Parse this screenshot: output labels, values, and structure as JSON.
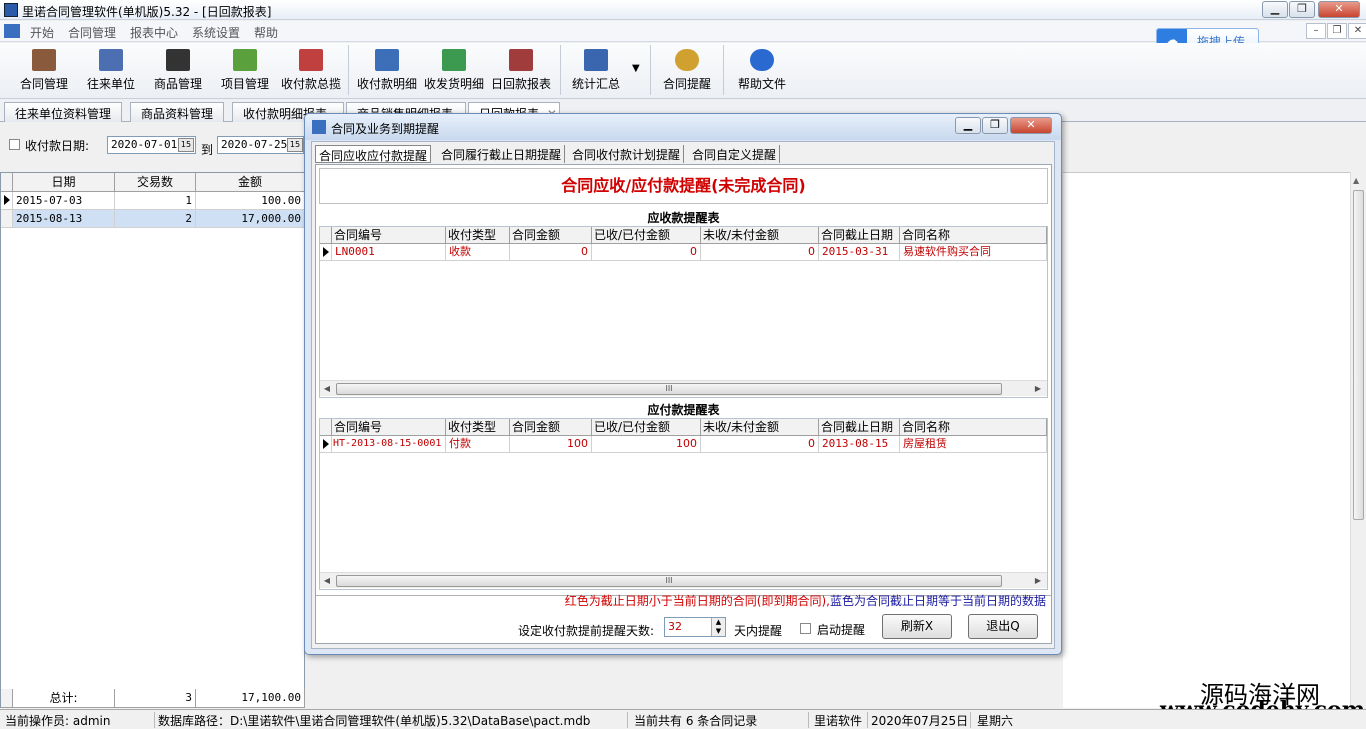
{
  "window": {
    "title": "里诺合同管理软件(单机版)5.32 - [日回款报表]"
  },
  "menu": [
    "开始",
    "合同管理",
    "报表中心",
    "系统设置",
    "帮助"
  ],
  "upload_button": "拖拽上传",
  "toolbar": [
    "合同管理",
    "往来单位",
    "商品管理",
    "项目管理",
    "收付款总揽",
    "收付款明细",
    "收发货明细",
    "日回款报表",
    "统计汇总",
    "合同提醒",
    "帮助文件"
  ],
  "tabs": [
    "往来单位资料管理",
    "商品资料管理",
    "收付款明细报表",
    "商品销售明细报表",
    "日回款报表"
  ],
  "filter": {
    "label": "收付款日期:",
    "from": "2020-07-01",
    "to_label": "到",
    "to": "2020-07-25",
    "cal_btn": "15"
  },
  "left_grid": {
    "headers": [
      "日期",
      "交易数",
      "金额"
    ],
    "rows": [
      [
        "2015-07-03",
        "1",
        "100.00"
      ],
      [
        "2015-08-13",
        "2",
        "17,000.00"
      ]
    ],
    "footer": [
      "总计:",
      "3",
      "17,100.00"
    ]
  },
  "dialog": {
    "title": "合同及业务到期提醒",
    "tabs": [
      "合同应收应付款提醒",
      "合同履行截止日期提醒",
      "合同收付款计划提醒",
      "合同自定义提醒"
    ],
    "banner": "合同应收/应付款提醒(未完成合同)",
    "receivable": {
      "title": "应收款提醒表",
      "headers": [
        "合同编号",
        "收付类型",
        "合同金额",
        "已收/已付金额",
        "未收/未付金额",
        "合同截止日期",
        "合同名称"
      ],
      "rows": [
        [
          "LN0001",
          "收款",
          "0",
          "0",
          "0",
          "2015-03-31",
          "易速软件购买合同"
        ]
      ]
    },
    "payable": {
      "title": "应付款提醒表",
      "headers": [
        "合同编号",
        "收付类型",
        "合同金额",
        "已收/已付金额",
        "未收/未付金额",
        "合同截止日期",
        "合同名称"
      ],
      "rows": [
        [
          "HT-2013-08-15-0001",
          "付款",
          "100",
          "100",
          "0",
          "2013-08-15",
          "房屋租赁"
        ]
      ]
    },
    "scroll_grip": "III",
    "legend_red": "红色为截止日期小于当前日期的合同(即到期合同),",
    "legend_blue": "蓝色为合同截止日期等于当前日期的数据",
    "days_label": "设定收付款提前提醒天数:",
    "days_value": "32",
    "days_suffix": "天内提醒",
    "auto_label": "启动提醒",
    "refresh_btn": "刷新Ⅹ",
    "exit_btn": "退出Q"
  },
  "status": {
    "operator": "当前操作员: admin",
    "db_path": "数据库路径：D:\\里诺软件\\里诺合同管理软件(单机版)5.32\\DataBase\\pact.mdb",
    "count": "当前共有 6 条合同记录",
    "company": "里诺软件",
    "date": "2020年07月25日",
    "weekday": "星期六"
  },
  "watermark": {
    "line1": "源码海洋网",
    "line2": "www.codehy.com"
  },
  "colors": {
    "red": "#d00000",
    "blue": "#1a1aa0"
  }
}
